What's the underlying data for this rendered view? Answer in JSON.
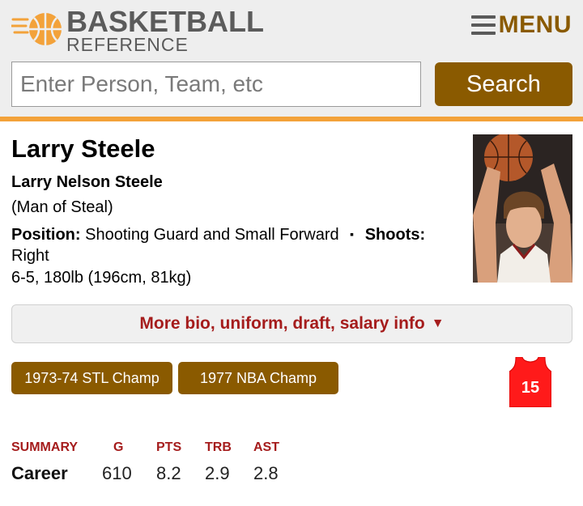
{
  "header": {
    "logo_line1": "BASKETBALL",
    "logo_line2": "REFERENCE",
    "menu_label": "MENU",
    "search_placeholder": "Enter Person, Team, etc",
    "search_button": "Search",
    "accent_color": "#f3a23a",
    "brand_color": "#8a5a00"
  },
  "player": {
    "name": "Larry Steele",
    "full_name": "Larry Nelson Steele",
    "nickname": "(Man of Steal)",
    "position_label": "Position:",
    "position_value": "Shooting Guard and Small Forward",
    "separator": "▪",
    "shoots_label": "Shoots:",
    "shoots_value": "Right",
    "size": "6-5, 180lb (196cm, 81kg)",
    "more_bio": "More bio, uniform, draft, salary info",
    "more_bio_arrow": "▼",
    "badges": [
      "1973-74 STL Champ",
      "1977 NBA Champ"
    ],
    "jersey_number": "15",
    "jersey_color": "#ff1a1a"
  },
  "summary": {
    "headers": [
      "SUMMARY",
      "G",
      "PTS",
      "TRB",
      "AST"
    ],
    "career_label": "Career",
    "values": [
      "610",
      "8.2",
      "2.9",
      "2.8"
    ]
  }
}
